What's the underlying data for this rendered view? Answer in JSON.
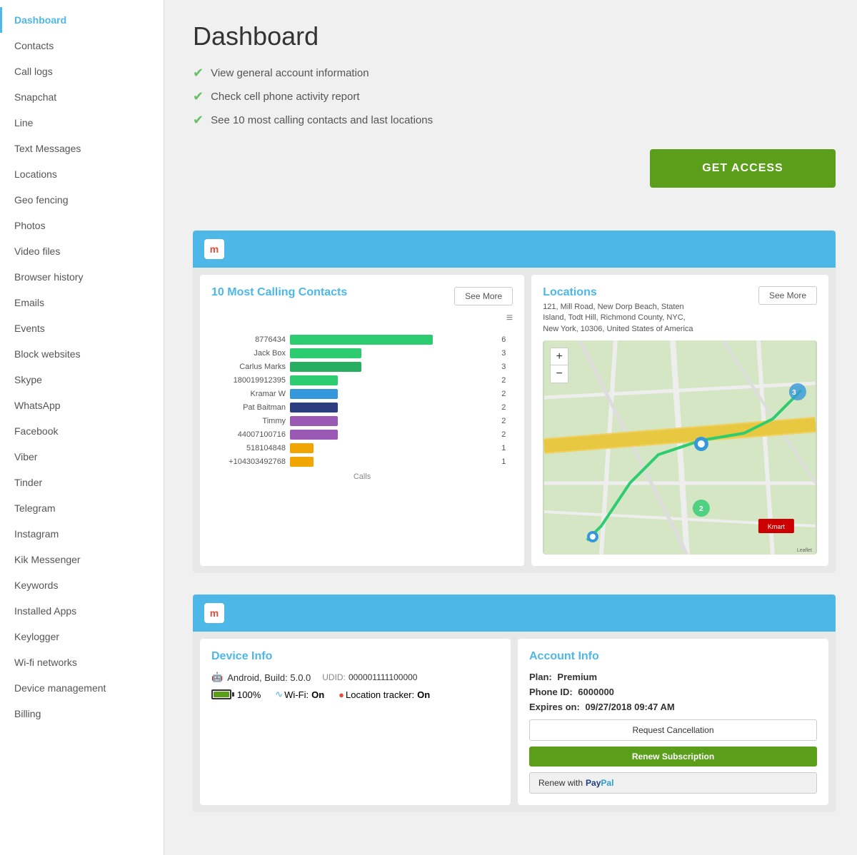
{
  "sidebar": {
    "items": [
      {
        "label": "Dashboard",
        "active": true
      },
      {
        "label": "Contacts",
        "active": false
      },
      {
        "label": "Call logs",
        "active": false
      },
      {
        "label": "Snapchat",
        "active": false
      },
      {
        "label": "Line",
        "active": false
      },
      {
        "label": "Text Messages",
        "active": false
      },
      {
        "label": "Locations",
        "active": false
      },
      {
        "label": "Geo fencing",
        "active": false
      },
      {
        "label": "Photos",
        "active": false
      },
      {
        "label": "Video files",
        "active": false
      },
      {
        "label": "Browser history",
        "active": false
      },
      {
        "label": "Emails",
        "active": false
      },
      {
        "label": "Events",
        "active": false
      },
      {
        "label": "Block websites",
        "active": false
      },
      {
        "label": "Skype",
        "active": false
      },
      {
        "label": "WhatsApp",
        "active": false
      },
      {
        "label": "Facebook",
        "active": false
      },
      {
        "label": "Viber",
        "active": false
      },
      {
        "label": "Tinder",
        "active": false
      },
      {
        "label": "Telegram",
        "active": false
      },
      {
        "label": "Instagram",
        "active": false
      },
      {
        "label": "Kik Messenger",
        "active": false
      },
      {
        "label": "Keywords",
        "active": false
      },
      {
        "label": "Installed Apps",
        "active": false
      },
      {
        "label": "Keylogger",
        "active": false
      },
      {
        "label": "Wi-fi networks",
        "active": false
      },
      {
        "label": "Device management",
        "active": false
      },
      {
        "label": "Billing",
        "active": false
      }
    ]
  },
  "header": {
    "title": "Dashboard"
  },
  "checklist": {
    "items": [
      {
        "text": "View general account information"
      },
      {
        "text": "Check cell phone activity report"
      },
      {
        "text": "See 10 most calling contacts and last locations"
      }
    ]
  },
  "get_access_button": "GET ACCESS",
  "contacts_panel": {
    "title": "10 Most Calling Contacts",
    "see_more": "See More",
    "x_label": "Calls",
    "bars": [
      {
        "label": "8776434",
        "value": 6,
        "max": 6,
        "color": "#2ecc71"
      },
      {
        "label": "Jack Box",
        "value": 3,
        "max": 6,
        "color": "#2ecc71"
      },
      {
        "label": "Carlus Marks",
        "value": 3,
        "max": 6,
        "color": "#27ae60"
      },
      {
        "label": "180019912395",
        "value": 2,
        "max": 6,
        "color": "#2ecc71"
      },
      {
        "label": "Kramar W",
        "value": 2,
        "max": 6,
        "color": "#3498db"
      },
      {
        "label": "Pat Baitman",
        "value": 2,
        "max": 6,
        "color": "#2c3e80"
      },
      {
        "label": "Timmy",
        "value": 2,
        "max": 6,
        "color": "#9b59b6"
      },
      {
        "label": "44007100716",
        "value": 2,
        "max": 6,
        "color": "#9b59b6"
      },
      {
        "label": "518104848",
        "value": 1,
        "max": 6,
        "color": "#f0a500"
      },
      {
        "label": "+104303492768",
        "value": 1,
        "max": 6,
        "color": "#f0a500"
      }
    ]
  },
  "locations_panel": {
    "title": "Locations",
    "see_more": "See More",
    "address": "121, Mill Road, New Dorp Beach, Staten Island, Todt Hill, Richmond County, NYC, New York, 10306, United States of America"
  },
  "device_panel": {
    "title": "Device Info",
    "os": "Android, Build: 5.0.0",
    "udid_label": "UDID:",
    "udid": "000001111100000",
    "battery_label": "100%",
    "wifi_label": "Wi-Fi:",
    "wifi_value": "On",
    "location_label": "Location tracker:",
    "location_value": "On"
  },
  "account_panel": {
    "title": "Account Info",
    "plan_label": "Plan:",
    "plan_value": "Premium",
    "phone_label": "Phone ID:",
    "phone_value": "6000000",
    "expires_label": "Expires on:",
    "expires_value": "09/27/2018 09:47 AM",
    "btn_cancel": "Request Cancellation",
    "btn_renew": "Renew Subscription",
    "btn_paypal": "Renew with PayPal"
  }
}
